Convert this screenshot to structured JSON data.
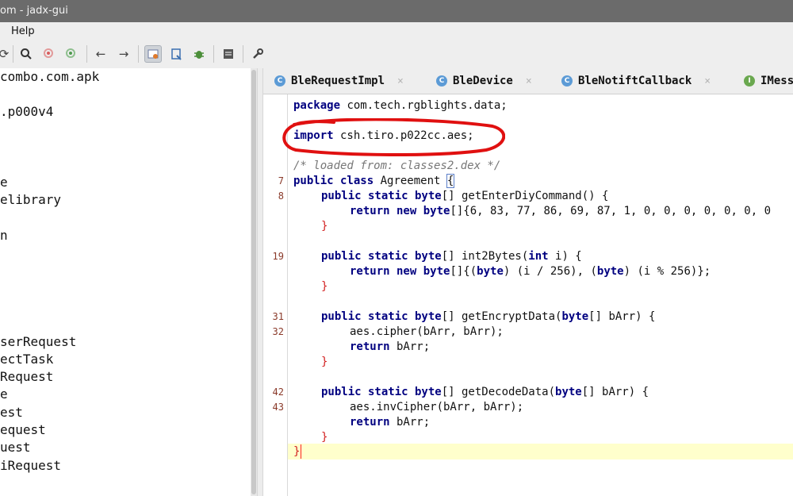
{
  "window": {
    "title": "om - jadx-gui"
  },
  "menu": {
    "help": "Help"
  },
  "toolbar": {
    "icons": [
      "sync-icon",
      "search-icon",
      "search-class-icon",
      "search-usage-icon",
      "back-icon",
      "forward-icon",
      "deobfuscation-icon",
      "quick-tab-icon",
      "debug-icon",
      "log-icon",
      "preferences-icon"
    ]
  },
  "tree": {
    "items": [
      "combo.com.apk",
      ".p000v4",
      "e",
      "elibrary",
      "n",
      "serRequest",
      "ectTask",
      "Request",
      "e",
      "est",
      "equest",
      "uest",
      "iRequest"
    ]
  },
  "tabs": [
    {
      "label": "BleRequestImpl",
      "icon": "C",
      "close": "×"
    },
    {
      "label": "BleDevice",
      "icon": "C",
      "close": "×"
    },
    {
      "label": "BleNotiftCallback",
      "icon": "C",
      "close": "×"
    },
    {
      "label": "IMess",
      "icon": "I"
    }
  ],
  "colors": {
    "keyword": "#000080",
    "current_line": "#ffffcc",
    "annotation_circle": "#e01010"
  },
  "code": {
    "line_numbers": [
      "7",
      "8",
      "19",
      "31",
      "32",
      "42",
      "43"
    ],
    "package_kw": "package",
    "package_name": " com.tech.rgblights.data;",
    "import_kw": "import",
    "import_name": " csh.tiro.p022cc.aes;",
    "comment": "/* loaded from: classes2.dex */",
    "class_kw": "public class",
    "class_name": " Agreement ",
    "class_brace": "{",
    "m1_kw": "public static byte",
    "m1_rest": "[] getEnterDiyCommand() {",
    "m1_ret_kw": "return new byte",
    "m1_ret_rest": "[]{6, 83, 77, 86, 69, 87, 1, 0, 0, 0, 0, 0, 0, 0",
    "m1_close": "}",
    "m2_kw": "public static byte",
    "m2_name": "[] int2Bytes(",
    "m2_param_kw": "int",
    "m2_param": " i) {",
    "m2_ret_kw": "return new byte",
    "m2_ret_a": "[]{(",
    "m2_ret_b": "byte",
    "m2_ret_c": ") (i / 256), (",
    "m2_ret_d": "byte",
    "m2_ret_e": ") (i % 256)};",
    "m2_close": "}",
    "m3_kw": "public static byte",
    "m3_name": "[] getEncryptData(",
    "m3_param_kw": "byte",
    "m3_param": "[] bArr) {",
    "m3_body1": "aes.cipher(bArr, bArr);",
    "m3_ret_kw": "return",
    "m3_ret": " bArr;",
    "m3_close": "}",
    "m4_kw": "public static byte",
    "m4_name": "[] getDecodeData(",
    "m4_param_kw": "byte",
    "m4_param": "[] bArr) {",
    "m4_body1": "aes.invCipher(bArr, bArr);",
    "m4_ret_kw": "return",
    "m4_ret": " bArr;",
    "m4_close": "}",
    "class_close": "}"
  }
}
